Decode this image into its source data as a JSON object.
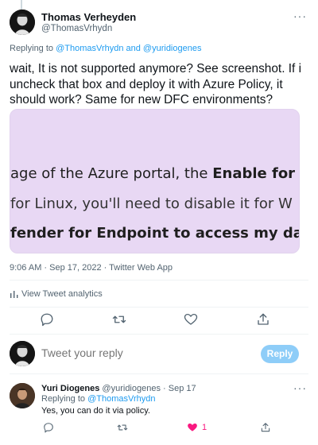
{
  "tweet": {
    "author_name": "Thomas Verheyden",
    "author_handle": "@ThomasVrhydn",
    "replying_prefix": "Replying to",
    "replying_to": "@ThomasVrhydn and @yuridiogenes",
    "text": "wait, It is not supported anymore? See screenshot. If i uncheck that box and deploy it with Azure Policy, it should work? Same for new DFC environments?",
    "media": {
      "line1_start": "age of the Azure portal, the ",
      "line1_bold": "Enable for",
      "line2": "for Linux, you'll need to disable it for W",
      "line3": "fender for Endpoint to access my data,"
    },
    "timestamp": "9:06 AM · Sep 17, 2022 · Twitter Web App",
    "analytics_label": "View Tweet analytics"
  },
  "compose": {
    "placeholder": "Tweet your reply",
    "button_label": "Reply"
  },
  "reply": {
    "author_name": "Yuri Diogenes",
    "author_handle": "@yuridiogenes",
    "date": "Sep 17",
    "replying_prefix": "Replying to",
    "replying_to": "@ThomasVrhydn",
    "text": "Yes, you can do it via policy.",
    "like_count": "1"
  },
  "icons": {
    "more": "more-icon",
    "analytics": "bar-chart-icon",
    "reply": "reply-icon",
    "retweet": "retweet-icon",
    "like": "heart-icon",
    "share": "share-icon"
  },
  "colors": {
    "accent": "#1d9bf0",
    "like": "#f91880",
    "reply_button": "#8ecdf8",
    "media_background": "#e8d8f4"
  }
}
